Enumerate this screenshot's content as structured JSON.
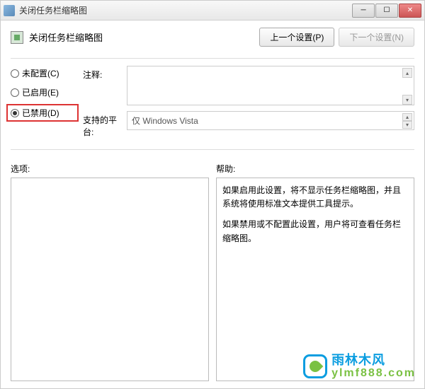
{
  "window": {
    "title": "关闭任务栏缩略图"
  },
  "header": {
    "policy_title": "关闭任务栏缩略图",
    "prev_btn": "上一个设置(P)",
    "next_btn": "下一个设置(N)"
  },
  "radios": {
    "not_configured": "未配置(C)",
    "enabled": "已启用(E)",
    "disabled": "已禁用(D)"
  },
  "fields": {
    "comment_label": "注释:",
    "platform_label": "支持的平台:",
    "platform_value": "仅 Windows Vista"
  },
  "lower": {
    "options_label": "选项:",
    "help_label": "帮助:",
    "help_p1": "如果启用此设置，将不显示任务栏缩略图，并且系统将使用标准文本提供工具提示。",
    "help_p2": "如果禁用或不配置此设置，用户将可查看任务栏缩略图。"
  },
  "watermark": {
    "brand": "雨林木风",
    "url": "ylmf888.com"
  }
}
